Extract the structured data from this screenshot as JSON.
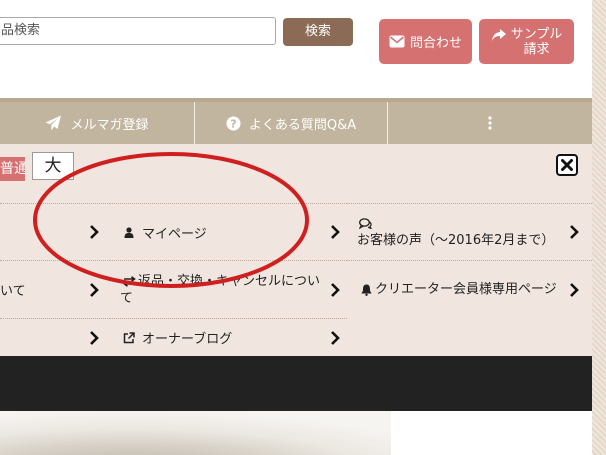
{
  "header": {
    "search": {
      "value": "品検索"
    },
    "search_button": "検索",
    "contact_button": "問合わせ",
    "sample_button": [
      "サンプル",
      "請求"
    ]
  },
  "navbar": {
    "items": [
      {
        "label": "メルマガ登録",
        "icon": "paper-plane-icon"
      },
      {
        "label": "よくある質問Q&A",
        "icon": "question-circle-icon"
      },
      {
        "label": "",
        "icon": "vertical-ellipsis-icon"
      }
    ]
  },
  "font_size": {
    "normal_label": "普通",
    "large_label": "大"
  },
  "menu": {
    "rows": [
      [
        {
          "label": "",
          "icon": ""
        },
        {
          "label": "マイページ",
          "icon": "user-icon"
        },
        {
          "label": "お客様の声（～2016年2月まで）",
          "icon": "comments-icon"
        }
      ],
      [
        {
          "label": "いて",
          "icon": ""
        },
        {
          "label": "返品・交換・キャンセルについて",
          "icon": "exchange-icon"
        },
        {
          "label": "クリエーター会員様専用ページ",
          "icon": "bell-icon"
        }
      ],
      [
        {
          "label": "",
          "icon": ""
        },
        {
          "label": "オーナーブログ",
          "icon": "external-link-icon"
        }
      ]
    ]
  },
  "colors": {
    "accent_button": "#d67171",
    "search_button": "#8b6b56",
    "navbar": "#c2b59f",
    "menu_background": "#f0e6df",
    "dark_band": "#222222",
    "annotation": "#d01f1f"
  }
}
